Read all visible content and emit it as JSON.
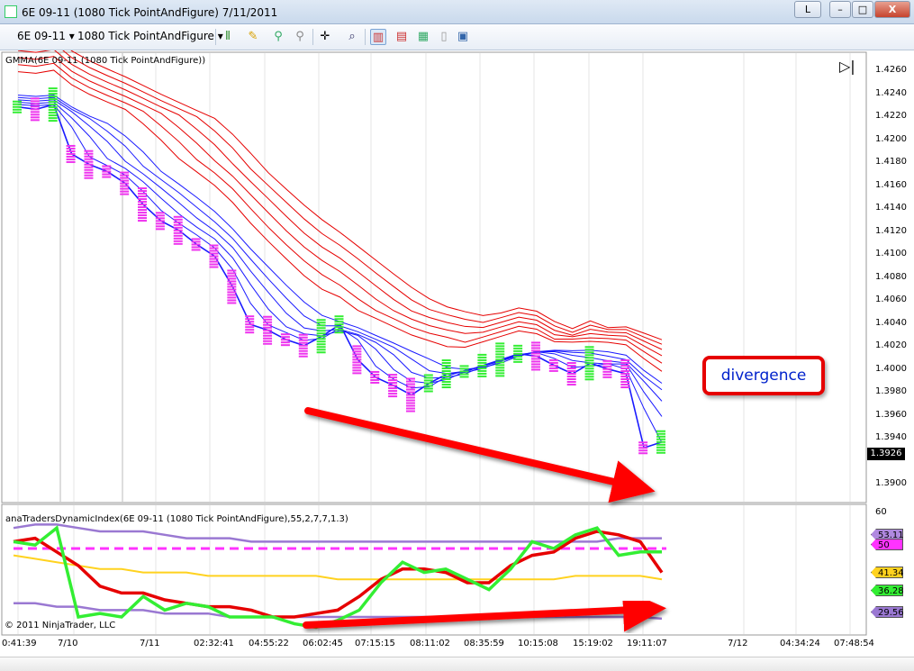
{
  "window": {
    "title": "6E 09-11 (1080 Tick PointAndFigure)  7/11/2011",
    "btn_l": "L",
    "btn_min": "–",
    "btn_max": "□",
    "btn_close": "X"
  },
  "toolbar": {
    "instrument": "6E 09-11",
    "period": "1080 Tick PointAndFigure"
  },
  "price_panel": {
    "label": "GMMA(6E 09-11 (1080 Tick PointAndFigure))",
    "last_price": "1.3926",
    "callout": "divergence",
    "axis_labels": [
      "1.4260",
      "1.4240",
      "1.4220",
      "1.4200",
      "1.4180",
      "1.4160",
      "1.4140",
      "1.4120",
      "1.4100",
      "1.4080",
      "1.4060",
      "1.4040",
      "1.4020",
      "1.4000",
      "1.3980",
      "1.3960",
      "1.3940",
      "1.3900"
    ]
  },
  "indicator_panel": {
    "label": "anaTradersDynamicIndex(6E 09-11 (1080 Tick PointAndFigure),55,2,7,7,1.3)",
    "axis_top": "60",
    "badges": [
      {
        "text": "53.11",
        "color": "#b089e0"
      },
      {
        "text": "50",
        "color": "#ff33ff"
      },
      {
        "text": "41.34",
        "color": "#ffd21f"
      },
      {
        "text": "36.28",
        "color": "#33ee33"
      },
      {
        "text": "29.56",
        "color": "#9a78d2"
      }
    ],
    "copyright": "© 2011 NinjaTrader, LLC"
  },
  "time_axis": [
    "0:41:39",
    "7/10",
    "7/11",
    "02:32:41",
    "04:55:22",
    "06:02:45",
    "07:15:15",
    "08:11:02",
    "08:35:59",
    "10:15:08",
    "15:19:02",
    "19:11:07",
    "7/12",
    "04:34:24",
    "07:48:54"
  ],
  "colors": {
    "up_box": "#33ee33",
    "down_box": "#ee33ee",
    "short_ema": "#1a1aff",
    "long_ema": "#e60000",
    "arrow": "#ff0000"
  },
  "chart_data": {
    "type": "line",
    "x": [
      0,
      1,
      2,
      3,
      4,
      5,
      6,
      7,
      8,
      9,
      10,
      11,
      12,
      13,
      14,
      15,
      16,
      17,
      18,
      19,
      20,
      21,
      22,
      23,
      24,
      25,
      26,
      27,
      28,
      29,
      30,
      31,
      32,
      33,
      34,
      35,
      36
    ],
    "series": [
      {
        "values": [
          1.4225,
          1.4223,
          1.4227,
          1.4185,
          1.4176,
          1.417,
          1.416,
          1.4142,
          1.4128,
          1.412,
          1.4108,
          1.4098,
          1.4072,
          1.404,
          1.4035,
          1.4027,
          1.4022,
          1.403,
          1.404,
          1.401,
          1.3995,
          1.3988,
          1.398,
          1.399,
          1.3998,
          1.4,
          1.4005,
          1.401,
          1.4015,
          1.4013,
          1.4005,
          1.3998,
          1.4007,
          1.4002,
          1.3998,
          1.3935,
          1.394
        ]
      }
    ],
    "ylim": [
      1.389,
      1.427
    ]
  }
}
